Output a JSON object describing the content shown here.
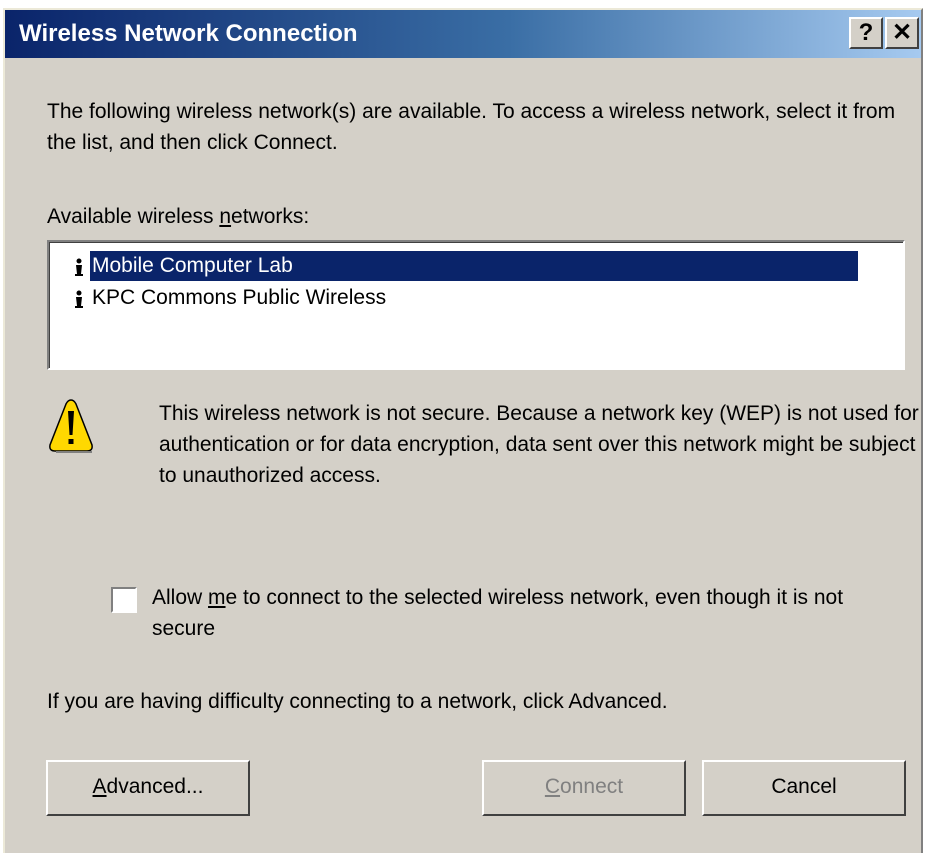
{
  "window": {
    "title": "Wireless Network Connection",
    "help_label": "?",
    "close_label": "✕"
  },
  "intro_text": "The following wireless network(s) are available. To access a wireless network, select it from the list, and then click Connect.",
  "available_label": {
    "before": "Available wireless ",
    "mnemonic": "n",
    "after": "etworks:"
  },
  "networks": [
    {
      "name": "Mobile Computer Lab",
      "selected": true,
      "icon": "wireless-antenna-icon"
    },
    {
      "name": "KPC Commons Public Wireless",
      "selected": false,
      "icon": "wireless-antenna-icon"
    }
  ],
  "warning_text": "This wireless network is not secure. Because a network key (WEP) is not used for authentication or for data encryption, data sent over this network might be subject to unauthorized access.",
  "allow_checkbox": {
    "checked": false,
    "label_before": "Allow ",
    "label_mnemonic": "m",
    "label_after": "e to connect to the selected wireless network, even though it is not secure"
  },
  "difficulty_text": "If you are having difficulty connecting to a network, click Advanced.",
  "buttons": {
    "advanced_mnemonic": "A",
    "advanced_rest": "dvanced...",
    "connect_mnemonic": "C",
    "connect_rest": "onnect",
    "connect_enabled": false,
    "cancel": "Cancel"
  },
  "colors": {
    "titlebar_start": "#0a246a",
    "titlebar_end": "#a6caf0",
    "dialog_face": "#d4d0c8",
    "selection": "#0a246a",
    "warning_yellow": "#ffd800"
  }
}
